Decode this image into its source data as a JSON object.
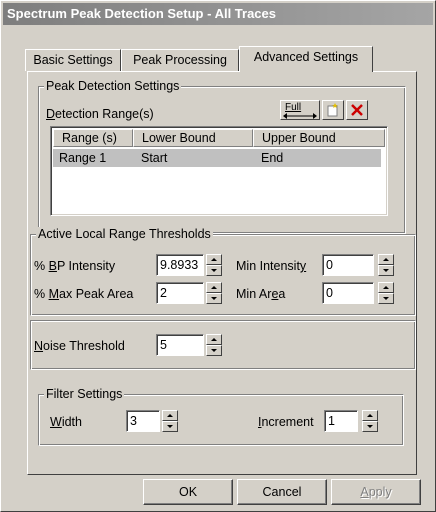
{
  "window": {
    "title": "Spectrum Peak Detection Setup - All Traces"
  },
  "tabs": [
    {
      "label": "Basic Settings"
    },
    {
      "label": "Peak Processing"
    },
    {
      "label": "Advanced Settings",
      "active": true
    }
  ],
  "peak_detection": {
    "group_label": "Peak Detection Settings",
    "range_label_prefix": "D",
    "range_label_rest": "etection Range(s)",
    "full_button": "Full",
    "columns": [
      "Range (s)",
      "Lower Bound",
      "Upper Bound"
    ],
    "rows": [
      {
        "range": "Range 1",
        "lower": "Start",
        "upper": "End",
        "selected": true
      }
    ]
  },
  "thresholds": {
    "group_label": "Active Local Range Thresholds",
    "bp_intensity": {
      "label_pre": "% ",
      "label_u": "B",
      "label_post": "P Intensity",
      "value": "9.8933"
    },
    "min_intensity": {
      "label_pre": "Min Intensit",
      "label_u": "y",
      "label_post": "",
      "value": "0"
    },
    "max_peak_area": {
      "label_pre": "% ",
      "label_u": "M",
      "label_post": "ax Peak Area",
      "value": "2"
    },
    "min_area": {
      "label_pre": "Min Ar",
      "label_u": "e",
      "label_post": "a",
      "value": "0"
    }
  },
  "noise": {
    "label_u": "N",
    "label_post": "oise Threshold",
    "value": "5"
  },
  "filter": {
    "group_label": "Filter Settings",
    "width": {
      "label_u": "W",
      "label_post": "idth",
      "value": "3"
    },
    "increment": {
      "label_u": "I",
      "label_post": "ncrement",
      "value": "1"
    }
  },
  "buttons": {
    "ok": "OK",
    "cancel": "Cancel",
    "apply_u": "A",
    "apply_post": "pply"
  },
  "colors": {
    "face": "#d4d0c8",
    "title_gradient_start": "#7e7e7e",
    "delete_icon": "#cc0000",
    "selected_row": "#c0c0c0"
  }
}
